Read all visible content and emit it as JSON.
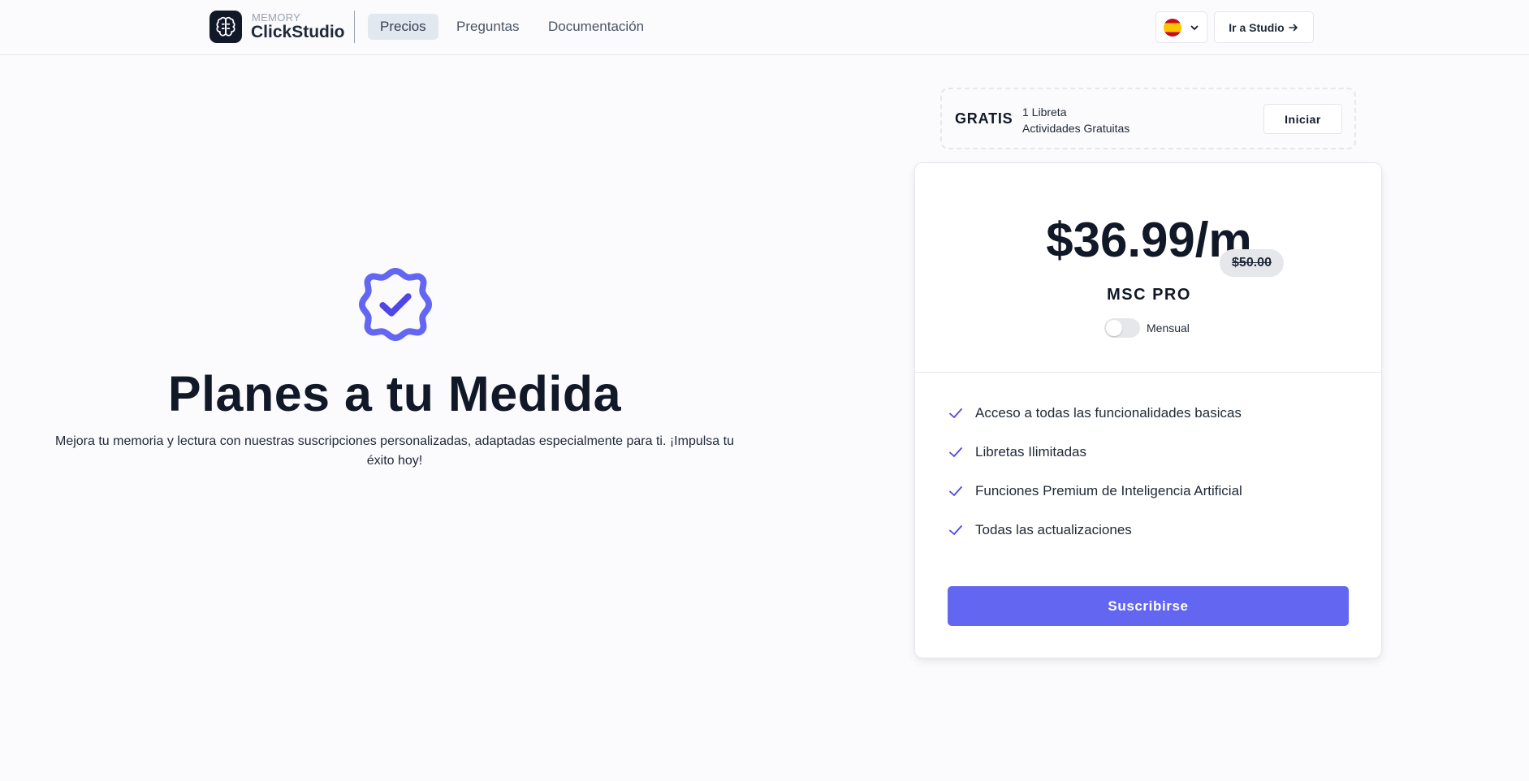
{
  "header": {
    "brand_small": "MEMORY",
    "brand_name": "ClickStudio",
    "nav": [
      {
        "label": "Precios",
        "active": true
      },
      {
        "label": "Preguntas",
        "active": false
      },
      {
        "label": "Documentación",
        "active": false
      }
    ],
    "language": "es",
    "studio_button": "Ir a Studio"
  },
  "hero": {
    "title": "Planes a tu Medida",
    "description": "Mejora tu memoria y lectura con nuestras suscripciones personalizadas, adaptadas especialmente para ti. ¡Impulsa tu éxito hoy!"
  },
  "free_plan": {
    "label": "GRATIS",
    "line1": "1 Libreta",
    "line2": "Actividades Gratuitas",
    "button": "Iniciar"
  },
  "pro_plan": {
    "price": "$36.99/m",
    "old_price": "$50.00",
    "name": "MSC PRO",
    "billing_label": "Mensual",
    "billing_annual": false,
    "features": [
      "Acceso a todas las funcionalidades basicas",
      "Libretas Ilimitadas",
      "Funciones Premium de Inteligencia Artificial",
      "Todas las actualizaciones"
    ],
    "button": "Suscribirse"
  },
  "colors": {
    "accent": "#6366f1",
    "background": "#fbfafd",
    "text": "#111827"
  }
}
